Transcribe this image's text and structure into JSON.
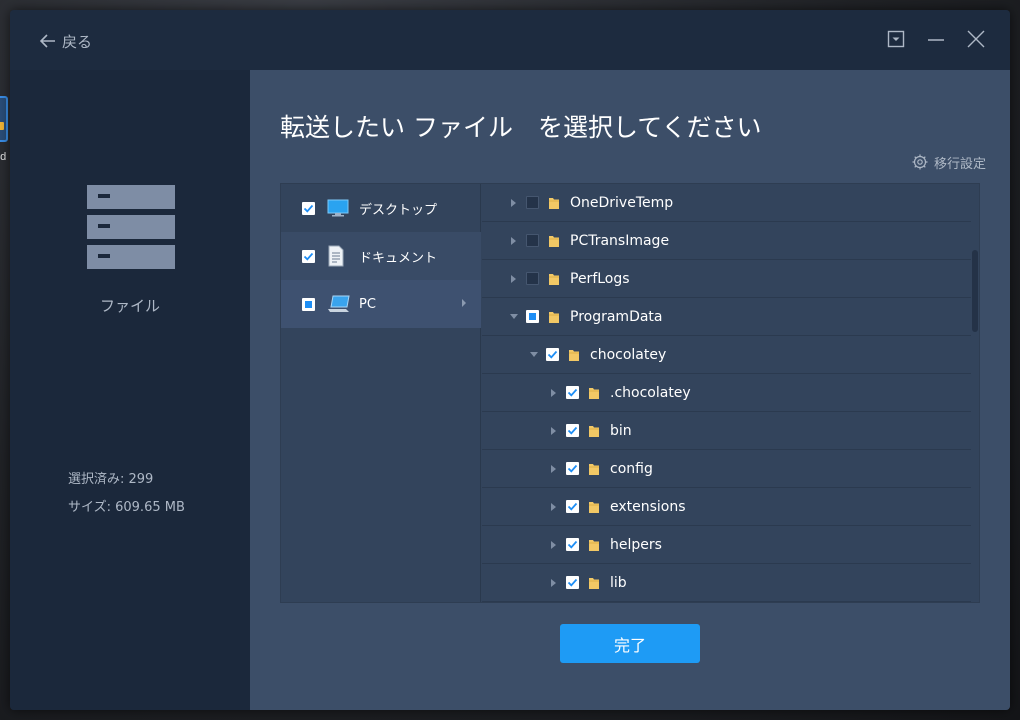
{
  "desktop": {
    "icon_label": "od\ns"
  },
  "header": {
    "back_label": "戻る"
  },
  "sidebar": {
    "category_label": "ファイル",
    "selected_count": "選択済み: 299",
    "size": "サイズ: 609.65 MB"
  },
  "main": {
    "title": "転送したい ファイル　を選択してください",
    "settings_label": "移行設定",
    "done_label": "完了"
  },
  "categories": [
    {
      "label": "デスクトップ",
      "state": "checked",
      "icon": "desktop-monitor-icon"
    },
    {
      "label": "ドキュメント",
      "state": "checked",
      "icon": "document-icon"
    },
    {
      "label": "PC",
      "state": "partial",
      "icon": "pc-computer-icon",
      "active": true
    }
  ],
  "tree": [
    {
      "name": "OneDriveTemp",
      "state": "empty",
      "expanded": false,
      "level": 0
    },
    {
      "name": "PCTransImage",
      "state": "empty",
      "expanded": false,
      "level": 0
    },
    {
      "name": "PerfLogs",
      "state": "empty",
      "expanded": false,
      "level": 0
    },
    {
      "name": "ProgramData",
      "state": "partial",
      "expanded": true,
      "level": 0
    },
    {
      "name": "chocolatey",
      "state": "checked",
      "expanded": true,
      "level": 1
    },
    {
      "name": ".chocolatey",
      "state": "checked",
      "expanded": false,
      "level": 2
    },
    {
      "name": "bin",
      "state": "checked",
      "expanded": false,
      "level": 2
    },
    {
      "name": "config",
      "state": "checked",
      "expanded": false,
      "level": 2
    },
    {
      "name": "extensions",
      "state": "checked",
      "expanded": false,
      "level": 2
    },
    {
      "name": "helpers",
      "state": "checked",
      "expanded": false,
      "level": 2
    },
    {
      "name": "lib",
      "state": "checked",
      "expanded": false,
      "level": 2
    }
  ],
  "colors": {
    "accent": "#1e9bf5",
    "checkbox_check": "#1e8ef5",
    "folder": "#f2c865"
  }
}
